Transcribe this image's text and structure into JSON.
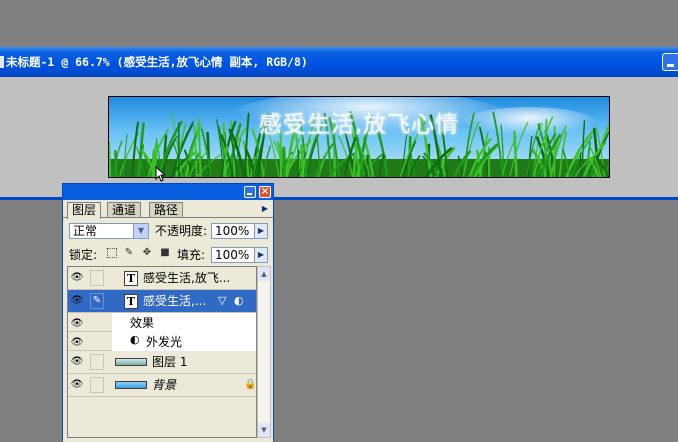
{
  "document": {
    "title": "未标题-1 @ 66.7% (感受生活,放飞心情 副本, RGB/8)",
    "banner_text": "感受生活,放飞心情"
  },
  "palette": {
    "tabs": [
      {
        "label": "图层",
        "active": true
      },
      {
        "label": "通道",
        "active": false
      },
      {
        "label": "路径",
        "active": false
      }
    ],
    "blend_mode": "正常",
    "opacity_label": "不透明度:",
    "opacity_value": "100%",
    "lock_label": "锁定:",
    "fill_label": "填充:",
    "fill_value": "100%",
    "layers": [
      {
        "name": "感受生活,放飞...",
        "type": "text",
        "visible": true,
        "selected": false
      },
      {
        "name": "感受生活,...",
        "type": "text",
        "visible": true,
        "selected": true
      },
      {
        "name": "效果",
        "type": "effects-header",
        "visible": true
      },
      {
        "name": "外发光",
        "type": "effect",
        "visible": true
      },
      {
        "name": "图层 1",
        "type": "image",
        "visible": true,
        "selected": false
      },
      {
        "name": "背景",
        "type": "background",
        "visible": true,
        "selected": false,
        "locked": true
      }
    ]
  },
  "colors": {
    "titlebar": "#0054e3",
    "selection": "#316ac5",
    "workspace": "#808080"
  }
}
